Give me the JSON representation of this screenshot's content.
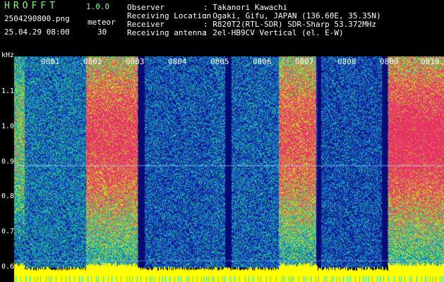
{
  "header": {
    "app_title": "HROFFT",
    "version": "1.0.0",
    "filename": "2504290800.png",
    "mode": "meteor",
    "datetime": "25.04.29 08:00",
    "count": "30"
  },
  "info": [
    {
      "label": "Observer",
      "value": ": Takanori Kawachi"
    },
    {
      "label": "Receiving Location",
      "value": ": Ogaki, Gifu, JAPAN (136.60E, 35.35N)"
    },
    {
      "label": "Receiver",
      "value": ": R820T2(RTL-SDR) SDR-Sharp 53.372MHz"
    },
    {
      "label": "Receiving antenna",
      "value": ": 2el-HB9CV Vertical (el. E-W)"
    }
  ],
  "axis": {
    "unit": "kHz",
    "ticks": [
      "1.1",
      "1.0",
      "0.9",
      "0.8",
      "0.7",
      "0.6"
    ]
  },
  "time_labels": [
    "0801",
    "0802",
    "0803",
    "0804",
    "0805",
    "0806",
    "0807",
    "0808",
    "0809",
    "0810"
  ],
  "colors": {
    "text_green": "#7fff7f",
    "text_white": "#ffffff",
    "baseline": "#ffff00",
    "noise_low": "#0a1a8a",
    "noise_high": "#e01060"
  }
}
